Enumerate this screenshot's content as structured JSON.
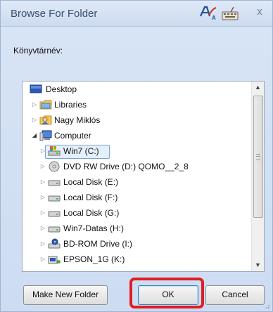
{
  "window": {
    "title": "Browse For Folder",
    "close_label": "x",
    "folder_name_label": "Könyvtárnév:"
  },
  "tree": {
    "items": [
      {
        "label": "Desktop",
        "icon": "desktop-icon",
        "expander": "none"
      },
      {
        "label": "Libraries",
        "icon": "libraries-folder-icon",
        "expander": "collapsed"
      },
      {
        "label": "Nagy Miklós",
        "icon": "user-folder-icon",
        "expander": "collapsed"
      },
      {
        "label": "Computer",
        "icon": "computer-icon",
        "expander": "expanded"
      },
      {
        "label": "Win7 (C:)",
        "icon": "system-drive-icon",
        "expander": "collapsed",
        "selected": true
      },
      {
        "label": "DVD RW Drive (D:) QOMO__2_8",
        "icon": "dvd-drive-icon",
        "expander": "collapsed"
      },
      {
        "label": "Local Disk (E:)",
        "icon": "hard-disk-icon",
        "expander": "collapsed"
      },
      {
        "label": "Local Disk (F:)",
        "icon": "hard-disk-icon",
        "expander": "collapsed"
      },
      {
        "label": "Local Disk (G:)",
        "icon": "hard-disk-icon",
        "expander": "collapsed"
      },
      {
        "label": "Win7-Datas (H:)",
        "icon": "hard-disk-icon",
        "expander": "collapsed"
      },
      {
        "label": "BD-ROM Drive (I:)",
        "icon": "bd-drive-icon",
        "expander": "collapsed"
      },
      {
        "label": "EPSON_1G (K:)",
        "icon": "memory-card-icon",
        "expander": "collapsed"
      }
    ]
  },
  "buttons": {
    "make_new_folder": "Make New Folder",
    "ok": "OK",
    "cancel": "Cancel"
  },
  "colors": {
    "highlight": "#e11d24",
    "selection_border": "#7da2ce",
    "dialog_background": "#d7e4f5"
  }
}
